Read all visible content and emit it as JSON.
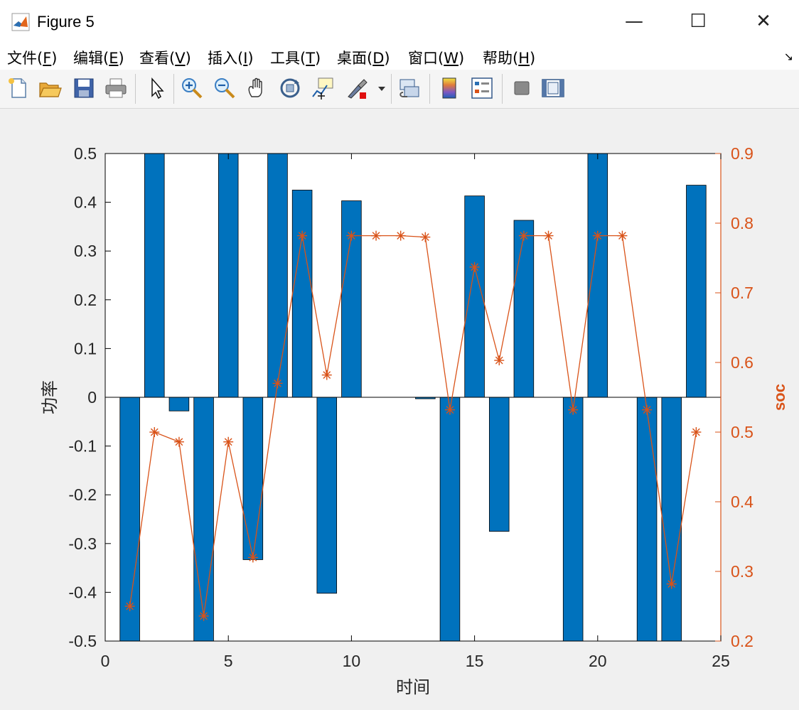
{
  "window": {
    "title": "Figure 5",
    "minimize_glyph": "—",
    "maximize_glyph": "☐",
    "close_glyph": "✕"
  },
  "menu": [
    {
      "label": "文件(",
      "key": "F",
      "tail": ")"
    },
    {
      "label": "编辑(",
      "key": "E",
      "tail": ")"
    },
    {
      "label": "查看(",
      "key": "V",
      "tail": ")"
    },
    {
      "label": "插入(",
      "key": "I",
      "tail": ")"
    },
    {
      "label": "工具(",
      "key": "T",
      "tail": ")"
    },
    {
      "label": "桌面(",
      "key": "D",
      "tail": ")"
    },
    {
      "label": "窗口(",
      "key": "W",
      "tail": ")"
    },
    {
      "label": "帮助(",
      "key": "H",
      "tail": ")"
    }
  ],
  "menu_corner_glyph": "↘",
  "toolbar": [
    "new-figure-icon",
    "open-file-icon",
    "save-icon",
    "print-icon",
    "pointer-icon",
    "zoom-in-icon",
    "zoom-out-icon",
    "pan-hand-icon",
    "rotate-3d-icon",
    "data-cursor-icon",
    "brush-icon",
    "brush-dropdown-icon",
    "link-plot-icon",
    "colorbar-icon",
    "legend-icon",
    "hide-plot-tools-icon",
    "show-plot-tools-icon"
  ],
  "colors": {
    "bar": "#0072BD",
    "line": "#D95319",
    "axes": "#000000"
  },
  "chart_data": {
    "type": "bar",
    "xlabel": "时间",
    "ylabel_left": "功率",
    "ylabel_right": "soc",
    "xlim": [
      0,
      25
    ],
    "ylim_left": [
      -0.5,
      0.5
    ],
    "ylim_right": [
      0.2,
      0.9
    ],
    "xticks": [
      "0",
      "5",
      "10",
      "15",
      "20",
      "25"
    ],
    "yticks_left": [
      "-0.5",
      "-0.4",
      "-0.3",
      "-0.2",
      "-0.1",
      "0",
      "0.1",
      "0.2",
      "0.3",
      "0.4",
      "0.5"
    ],
    "yticks_right": [
      "0.2",
      "0.3",
      "0.4",
      "0.5",
      "0.6",
      "0.7",
      "0.8",
      "0.9"
    ],
    "x": [
      1,
      2,
      3,
      4,
      5,
      6,
      7,
      8,
      9,
      10,
      11,
      12,
      13,
      14,
      15,
      16,
      17,
      18,
      19,
      20,
      21,
      22,
      23,
      24
    ],
    "series": [
      {
        "type": "bar",
        "axis": "left",
        "values": [
          -0.5,
          0.5,
          -0.028,
          -0.5,
          0.5,
          -0.333,
          0.5,
          0.425,
          -0.402,
          0.403,
          0,
          0,
          -0.003,
          -0.5,
          0.413,
          -0.275,
          0.363,
          0,
          -0.5,
          0.5,
          0,
          -0.5,
          -0.5,
          0.435
        ]
      },
      {
        "type": "line",
        "axis": "right",
        "marker": "*",
        "values": [
          0.25,
          0.5,
          0.486,
          0.236,
          0.486,
          0.32,
          0.57,
          0.782,
          0.582,
          0.782,
          0.782,
          0.782,
          0.78,
          0.532,
          0.737,
          0.603,
          0.782,
          0.782,
          0.532,
          0.782,
          0.782,
          0.532,
          0.282,
          0.5
        ]
      }
    ]
  }
}
